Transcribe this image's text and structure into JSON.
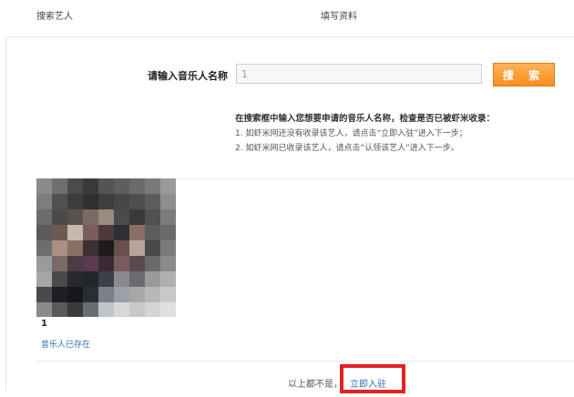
{
  "steps": {
    "step1": "搜索艺人",
    "step2": "填写资料"
  },
  "search": {
    "label": "请输入音乐人名称",
    "value": "1",
    "button_label": "搜 索"
  },
  "hints": {
    "title": "在搜索框中输入您想要申请的音乐人名称，检查是否已被虾米收录：",
    "line1": "1. 如虾米网还没有收录该艺人，请点击“立即入驻”进入下一步；",
    "line2": "2. 如虾米网已收录该艺人，请点击“认领该艺人”进入下一步。"
  },
  "result": {
    "artist_name": "1",
    "status": "音乐人已存在"
  },
  "footer": {
    "prefix": "以上都不是，",
    "join_label": "立即入驻"
  },
  "colors": {
    "accent_orange": "#f78e1e",
    "link_blue": "#2e6fb5",
    "highlight_red": "#e32222"
  }
}
